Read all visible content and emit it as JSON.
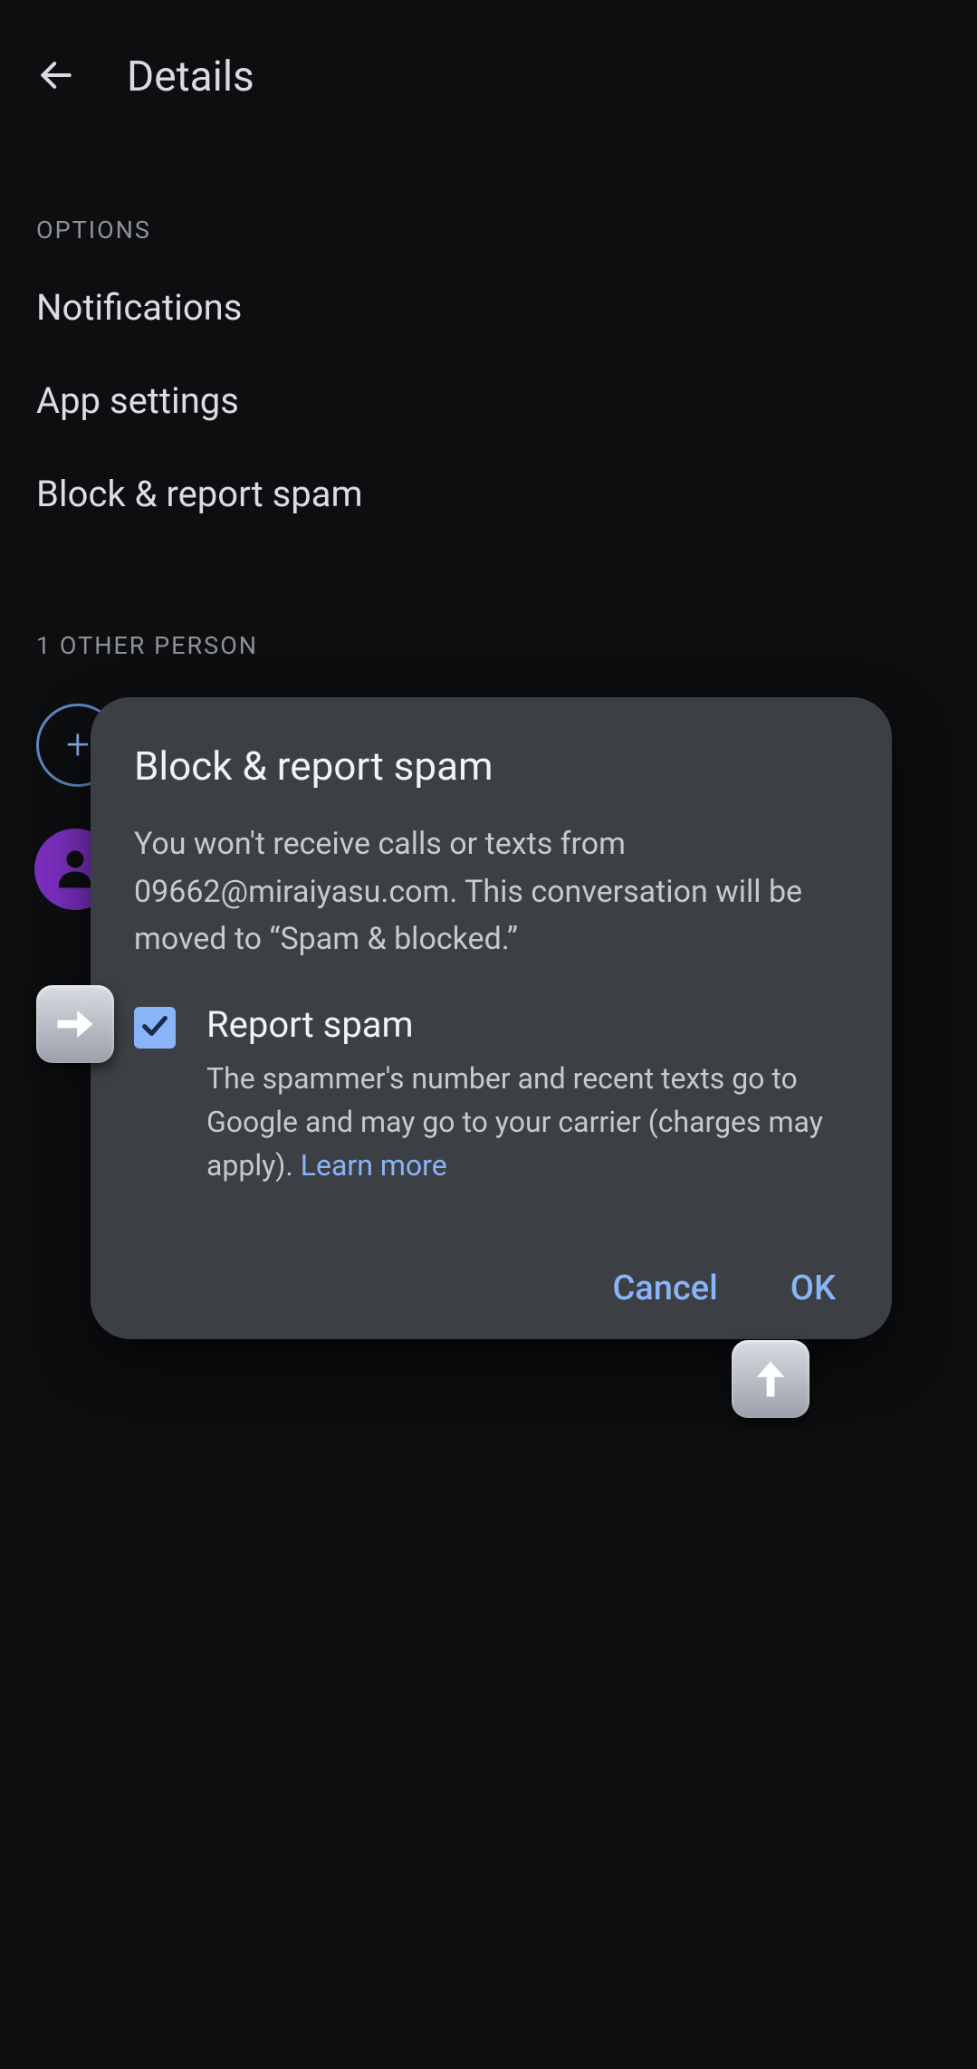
{
  "header": {
    "title": "Details"
  },
  "sections": {
    "options_label": "OPTIONS",
    "other_person_label": "1 OTHER PERSON"
  },
  "options": {
    "notifications": "Notifications",
    "app_settings": "App settings",
    "block_report": "Block & report spam"
  },
  "add_person_glyph": "+",
  "dialog": {
    "title": "Block & report spam",
    "body": "You won't receive calls or texts from 09662@miraiyasu.com. This conversation will be moved to “Spam & blocked.”",
    "checkbox_checked": true,
    "report_title": "Report spam",
    "report_desc_prefix": "The spammer's number and recent texts go to Google and may go to your carrier (charges may apply). ",
    "learn_more": "Learn more",
    "cancel": "Cancel",
    "ok": "OK"
  }
}
